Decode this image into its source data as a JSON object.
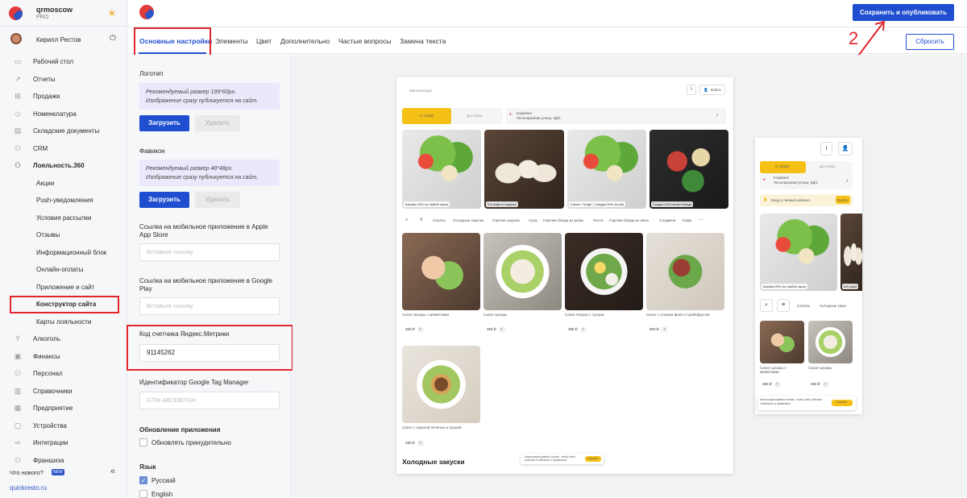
{
  "account": {
    "name": "qrmoscow",
    "plan": "PRO"
  },
  "user": {
    "name": "Кирилл Рестов"
  },
  "sidebar": {
    "items": [
      {
        "label": "Рабочий стол",
        "icon": "desktop-icon"
      },
      {
        "label": "Отчеты",
        "icon": "chart-icon"
      },
      {
        "label": "Продажи",
        "icon": "cart-icon"
      },
      {
        "label": "Номенклатура",
        "icon": "tag-icon"
      },
      {
        "label": "Складские документы",
        "icon": "box-icon"
      },
      {
        "label": "CRM",
        "icon": "crm-icon"
      },
      {
        "label": "Лояльность.360",
        "icon": "loyalty-icon"
      }
    ],
    "sub": [
      "Акции",
      "Push-уведомления",
      "Условия рассылки",
      "Отзывы",
      "Информационный блок",
      "Онлайн-оплаты",
      "Приложение и сайт",
      "Конструктор сайта",
      "Карты лояльности"
    ],
    "items2": [
      {
        "label": "Алкоголь",
        "icon": "glass-icon"
      },
      {
        "label": "Финансы",
        "icon": "wallet-icon"
      },
      {
        "label": "Персонал",
        "icon": "people-icon"
      },
      {
        "label": "Справочники",
        "icon": "book-icon"
      },
      {
        "label": "Предприятие",
        "icon": "building-icon"
      },
      {
        "label": "Устройства",
        "icon": "device-icon"
      },
      {
        "label": "Интеграции",
        "icon": "link-icon"
      },
      {
        "label": "Франшиза",
        "icon": "franchise-icon"
      }
    ],
    "whats_new": "Что нового?",
    "new_badge": "NEW",
    "site": "quickresto.ru"
  },
  "topbar": {
    "publish": "Сохранить и опубликовать",
    "reset": "Сбросить"
  },
  "tabs": [
    "Основные настройки",
    "Элементы",
    "Цвет",
    "Дополнительно",
    "Частые вопросы",
    "Замена текста"
  ],
  "form": {
    "logo_label": "Логотип",
    "logo_hint1": "Рекомендуемый размер 199*60px.",
    "logo_hint2": "Изображение сразу публикуется на сайт.",
    "upload": "Загрузить",
    "delete": "Удалить",
    "favicon_label": "Фавикон",
    "fav_hint1": "Рекомендуемый размер 48*48px.",
    "fav_hint2": "Изображение сразу публикуется на сайт.",
    "apple_label": "Ссылка на мобильное приложение в Apple App Store",
    "apple_ph": "Вставьте ссылку",
    "google_label": "Ссылка на мобильное приложение в Google Play",
    "google_ph": "Вставьте ссылку",
    "metrika_label": "Код счетчика Яндекс.Метрики",
    "metrika_value": "91145262",
    "gtm_label": "Идентификатор Google Tag Manager",
    "gtm_ph": "GTM-ABCDEFGH",
    "update_title": "Обновление приложения",
    "update_force": "Обновлять принудительно",
    "lang_title": "Язык",
    "lang_ru": "Русский",
    "lang_en": "English"
  },
  "annotations": {
    "one": "1",
    "two": "2"
  },
  "preview": {
    "company": "Магнитогорск",
    "login": "Войти",
    "takeaway": "С собой",
    "delivery": "Доставка",
    "addr_title": "Кофейня",
    "addr": "Лесопарковая улица, 9Д/1",
    "promos": [
      "Кэшбек 25% на любой салат",
      "5-й кофе в подарок",
      "Салат + Кофе = Скидка 30% за оба",
      "Скидка 10% на все блюда"
    ],
    "cats": [
      "Салаты",
      "Холодные закуски",
      "Горячие закуски",
      "Супы",
      "Горячие блюда из рыбы",
      "Паста",
      "Горячие блюда из мяса",
      "Сэндвичи",
      "Кофе"
    ],
    "products": [
      {
        "name": "Салат Цезарь с креветками",
        "price": "350 ₽"
      },
      {
        "name": "Салат Цезарь",
        "price": "350 ₽"
      },
      {
        "name": "Салат Нисуаз с тунцом",
        "price": "390 ₽"
      },
      {
        "name": "Салат с утиным филе и грейпфрутом",
        "price": "500 ₽"
      },
      {
        "name": "Салат с куриной печенью и грушей",
        "price": "390 ₽"
      }
    ],
    "section2": "Холодные закуски",
    "cookie_text": "Используем файлы cookie, чтобы сайт работал стабильно и правильно",
    "cookie_btn": "Хорошо",
    "mob_login_hint": "Вход в личный кабинет",
    "mob_login": "Войти",
    "mob_promo": "Кэшбек 25% на любой салат",
    "mob_promo2": "5-й кофе",
    "mob_cats": [
      "Салаты",
      "Холодные закус"
    ],
    "mob_products": [
      {
        "name": "Салат Цезарь с креветками",
        "price": "350 ₽"
      },
      {
        "name": "Салат Цезарь",
        "price": "350 ₽"
      }
    ]
  }
}
